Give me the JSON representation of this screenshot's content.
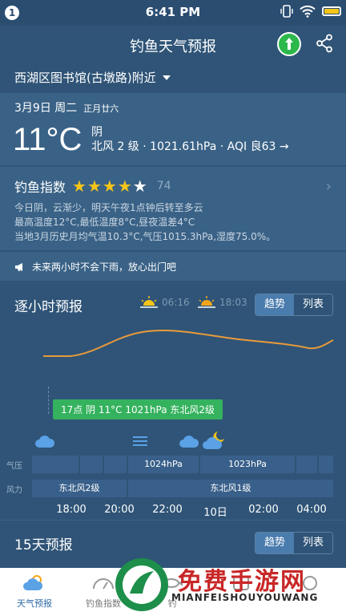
{
  "status_bar": {
    "notification_count": "1",
    "time": "6:41 PM"
  },
  "header": {
    "title": "钓鱼天气预报",
    "map_icon": "route-sign-icon",
    "share_icon": "share-icon"
  },
  "location": {
    "text": "西湖区图书馆(古墩路)附近"
  },
  "today": {
    "date": "3月9日 周二",
    "lunar": "正月廿六",
    "temperature": "11°C",
    "condition": "阴",
    "details": "北风 2 级 · 1021.61hPa · AQI 良63 →"
  },
  "fishing_index": {
    "title": "钓鱼指数",
    "stars_filled": 4,
    "stars_total": 5,
    "score": "74",
    "lines": [
      "今日阴，云渐少，明天午夜1点钟后转至多云",
      "最高温度12°C,最低温度8°C,昼夜温差4°C",
      "当地3月历史月均气温10.3°C,气压1015.3hPa,湿度75.0%。"
    ]
  },
  "alert": {
    "text": "未来两小时不会下雨，放心出门吧"
  },
  "hourly": {
    "title": "逐小时预报",
    "sunrise": "06:16",
    "sunset": "18:03",
    "toggle": {
      "trend": "趋势",
      "list": "列表",
      "selected": "trend"
    },
    "tooltip": "17点 阴 11°C 1021hPa 东北风2级",
    "pressure_label": "气压",
    "wind_label": "风力",
    "pressure_cells": [
      "1024hPa",
      "1023hPa"
    ],
    "wind_cells": [
      "东北风2级",
      "东北风1级"
    ],
    "times": [
      "18:00",
      "20:00",
      "22:00",
      "10日",
      "02:00",
      "04:00"
    ],
    "icons": [
      "cloud-icon",
      "haze-icon",
      "cloud-icon",
      "cloudy-night-icon"
    ]
  },
  "daily": {
    "title": "15天预报",
    "toggle": {
      "trend": "趋势",
      "list": "列表",
      "selected": "trend"
    }
  },
  "tabs": [
    {
      "label": "天气预报",
      "icon": "weather-tab-icon",
      "active": true
    },
    {
      "label": "钓鱼指数",
      "icon": "gauge-tab-icon",
      "active": false
    },
    {
      "label": "钓",
      "icon": "fish-tab-icon",
      "active": false
    },
    {
      "label": "",
      "icon": "tab-icon",
      "active": false
    },
    {
      "label": "",
      "icon": "tab-icon",
      "active": false
    }
  ],
  "watermark": {
    "title": "免费手游网",
    "subtitle": "MIANFEISHOUYOUWANG"
  }
}
